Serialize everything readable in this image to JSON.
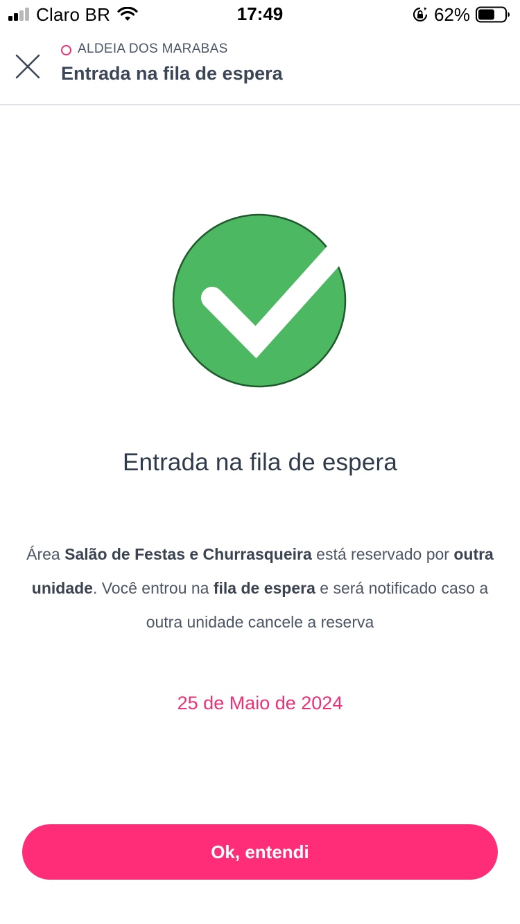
{
  "status_bar": {
    "carrier": "Claro BR",
    "time": "17:49",
    "battery_percent": "62%",
    "battery_level": 0.62,
    "signal_bars": 2,
    "icons": [
      "signal-icon",
      "wifi-icon",
      "orientation-lock-icon",
      "battery-icon"
    ]
  },
  "header": {
    "condo_name": "ALDEIA DOS MARABAS",
    "title": "Entrada na fila de espera",
    "close_icon": "close-icon"
  },
  "content": {
    "success_icon": "check-circle-icon",
    "title": "Entrada na fila de espera",
    "message": {
      "p1": "Área ",
      "area_name": "Salão de Festas e Churrasqueira",
      "p2": " está reservado por ",
      "reserved_by": "outra unidade",
      "p3": ". Você entrou na ",
      "queue": "fila de espera",
      "p4": " e será notificado caso a outra unidade cancele a reserva"
    },
    "date": "25 de Maio de 2024"
  },
  "actions": {
    "ok_label": "Ok, entendi"
  },
  "colors": {
    "accent": "#ff2d78",
    "condo_dot": "#f02e74",
    "date_text": "#f02e74",
    "check_fill": "#4cb962",
    "check_border": "#1f5a2c",
    "text_dark": "#2f3a4a"
  }
}
